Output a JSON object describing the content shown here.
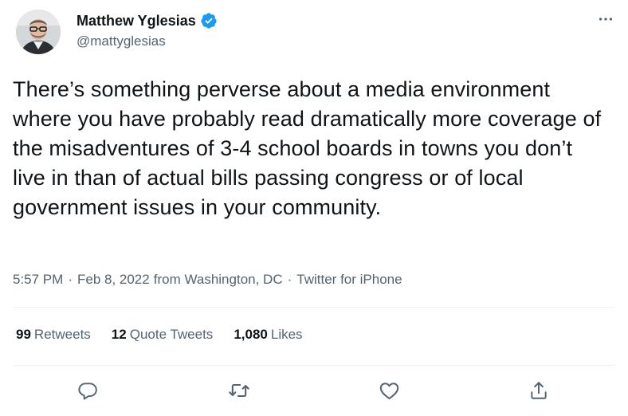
{
  "author": {
    "display_name": "Matthew Yglesias",
    "handle": "@mattyglesias",
    "verified": true
  },
  "tweet": {
    "text": "There’s something perverse about a media environment where you have probably read dramatically more coverage of the misadventures of 3-4 school boards in towns you don’t live in than of actual bills passing congress or of local government issues in your community.",
    "time": "5:57 PM",
    "date": "Feb 8, 2022",
    "location": "from Washington, DC",
    "source": "Twitter for iPhone",
    "separator": "·"
  },
  "stats": {
    "retweets_count": "99",
    "retweets_label": "Retweets",
    "quotes_count": "12",
    "quotes_label": "Quote Tweets",
    "likes_count": "1,080",
    "likes_label": "Likes"
  },
  "icons": {
    "verified": "verified-badge-icon",
    "more": "more-horizontal-icon",
    "reply": "reply-icon",
    "retweet": "retweet-icon",
    "like": "heart-icon",
    "share": "share-icon"
  },
  "colors": {
    "text_primary": "#0f1419",
    "text_secondary": "#536471",
    "verified_blue": "#1d9bf0",
    "divider": "#eff3f4"
  }
}
